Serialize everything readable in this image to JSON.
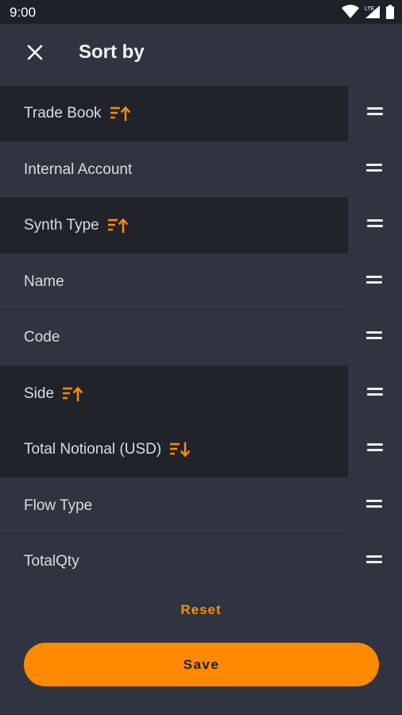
{
  "status_bar": {
    "time": "9:00",
    "network_label": "LTE"
  },
  "header": {
    "title": "Sort by"
  },
  "rows": [
    {
      "label": "Trade Book",
      "active": true,
      "sort": "ascending"
    },
    {
      "label": "Internal Account",
      "active": false,
      "sort": "none"
    },
    {
      "label": "Synth Type",
      "active": true,
      "sort": "ascending"
    },
    {
      "label": "Name",
      "active": false,
      "sort": "none"
    },
    {
      "label": "Code",
      "active": false,
      "sort": "none"
    },
    {
      "label": "Side",
      "active": true,
      "sort": "ascending"
    },
    {
      "label": "Total Notional (USD)",
      "active": true,
      "sort": "descending"
    },
    {
      "label": "Flow Type",
      "active": false,
      "sort": "none"
    },
    {
      "label": "TotalQty",
      "active": false,
      "sort": "none"
    }
  ],
  "footer": {
    "reset_label": "Reset",
    "save_label": "Save"
  },
  "colors": {
    "accent": "#ff8a00",
    "background": "#2f3440",
    "active_row": "#202329"
  }
}
